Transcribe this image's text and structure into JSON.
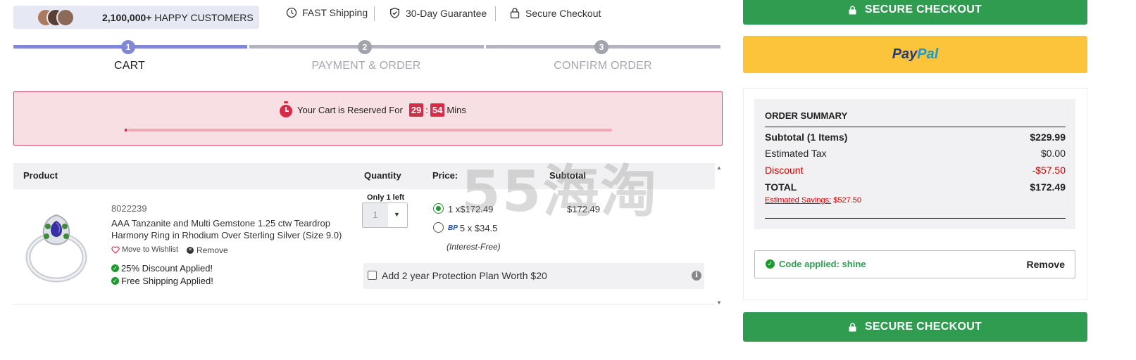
{
  "trust_bar": {
    "customer_count": "2,100,000+",
    "customer_label": "HAPPY CUSTOMERS",
    "items": [
      {
        "icon": "clock-icon",
        "label": "FAST Shipping"
      },
      {
        "icon": "shield-check-icon",
        "label": "30-Day Guarantee"
      },
      {
        "icon": "lock-icon",
        "label": "Secure Checkout"
      }
    ]
  },
  "steps": [
    {
      "number": "1",
      "label": "CART",
      "active": true
    },
    {
      "number": "2",
      "label": "PAYMENT & ORDER",
      "active": false
    },
    {
      "number": "3",
      "label": "CONFIRM ORDER",
      "active": false
    }
  ],
  "reservation": {
    "prefix": "Your Cart is Reserved For",
    "minutes": "29",
    "separator": ":",
    "seconds": "54",
    "suffix": "Mins"
  },
  "table": {
    "headers": {
      "product": "Product",
      "quantity": "Quantity",
      "price": "Price:",
      "subtotal": "Subtotal"
    }
  },
  "item": {
    "sku": "8022239",
    "name": "AAA Tanzanite and Multi Gemstone 1.25 ctw Teardrop Harmony Ring in Rhodium Over Sterling Silver (Size 9.0)",
    "wishlist_label": "Move to Wishlist",
    "remove_label": "Remove",
    "discount_applied": "25% Discount Applied!",
    "shipping_applied": "Free Shipping Applied!",
    "stock_note": "Only 1 left",
    "quantity": "1",
    "price_options": [
      {
        "label": "1 x$172.49",
        "selected": true
      },
      {
        "badge": "BP",
        "label": "5 x $34.5",
        "selected": false
      }
    ],
    "interest_note": "(Interest-Free)",
    "subtotal": "$172.49",
    "protection_label": "Add 2 year Protection Plan Worth $20",
    "protection_checked": false
  },
  "watermark": "55海淘",
  "checkout": {
    "button_label": "SECURE CHECKOUT",
    "paypal_part1": "Pay",
    "paypal_part2": "Pal"
  },
  "summary": {
    "title": "ORDER SUMMARY",
    "subtotal_label": "Subtotal (1 Items)",
    "subtotal_value": "$229.99",
    "tax_label": "Estimated Tax",
    "tax_value": "$0.00",
    "discount_label": "Discount",
    "discount_value": "-$57.50",
    "total_label": "TOTAL",
    "total_value": "$172.49",
    "savings_label": "Estimated Savings:",
    "savings_value": "$527.50"
  },
  "coupon": {
    "applied_text": "Code applied: shine",
    "remove_label": "Remove"
  },
  "colors": {
    "step_active": "#8088d6",
    "step_inactive": "#b4b4c0",
    "checkout_green": "#2f9c50",
    "paypal_yellow": "#fcc43a",
    "discount_red": "#d40000",
    "timer_red": "#d92b47"
  }
}
